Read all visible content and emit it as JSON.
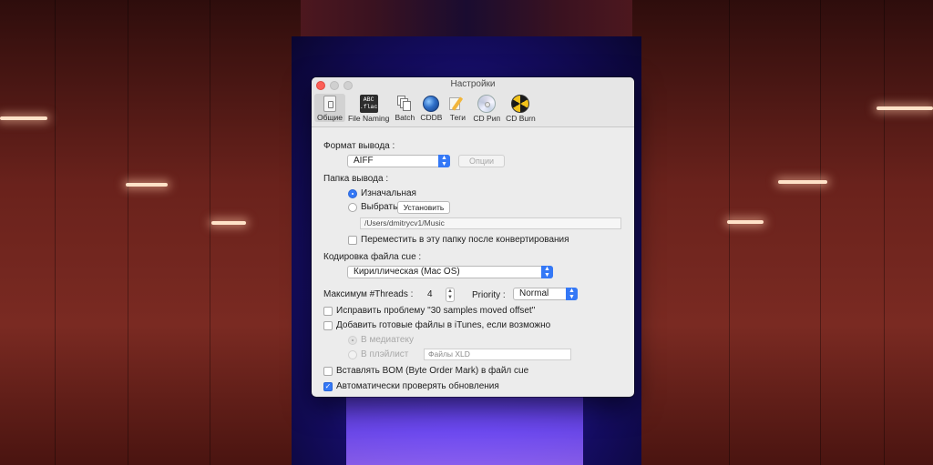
{
  "window": {
    "title": "Настройки"
  },
  "toolbar": {
    "items": [
      {
        "label": "Общие",
        "icon": "general-switch-icon",
        "active": true
      },
      {
        "label": "File Naming",
        "icon": "abc-flac-icon"
      },
      {
        "label": "Batch",
        "icon": "batch-documents-icon"
      },
      {
        "label": "CDDB",
        "icon": "globe-icon"
      },
      {
        "label": "Теги",
        "icon": "tag-pencil-icon"
      },
      {
        "label": "CD Рип",
        "icon": "cd-disc-icon"
      },
      {
        "label": "CD Burn",
        "icon": "radiation-icon"
      }
    ],
    "abc_icon_text": "ABC\n.flac"
  },
  "output_format": {
    "label": "Формат вывода :",
    "selected": "AIFF",
    "options_button": "Опции"
  },
  "output_folder": {
    "label": "Папка вывода :",
    "option_original": "Изначальная",
    "option_choose": "Выбрать",
    "set_button": "Установить",
    "path": "/Users/dmitrycv1/Music",
    "move_checkbox": "Переместить в эту папку после конвертирования"
  },
  "cue_encoding": {
    "label": "Кодировка файла cue :",
    "selected": "Кириллическая (Mac OS)"
  },
  "threads": {
    "label": "Максимум #Threads :",
    "value": "4",
    "priority_label": "Priority :",
    "priority_selected": "Normal"
  },
  "options": {
    "fix_offset": "Исправить проблему \"30 samples moved offset\"",
    "add_itunes": "Добавить готовые файлы в iTunes, если возможно",
    "to_library": "В медиатеку",
    "to_playlist": "В плэйлист",
    "playlist_placeholder": "Файлы XLD",
    "insert_bom": "Вставлять BOM (Byte Order Mark) в файл cue",
    "auto_update": "Автоматически проверять обновления"
  },
  "states": {
    "original_selected": true,
    "move_checked": false,
    "fix_offset_checked": false,
    "add_itunes_checked": false,
    "insert_bom_checked": false,
    "auto_update_checked": true
  },
  "colors": {
    "accent": "#3478f6",
    "close_button": "#fc5f57",
    "window_bg": "#ececec"
  }
}
